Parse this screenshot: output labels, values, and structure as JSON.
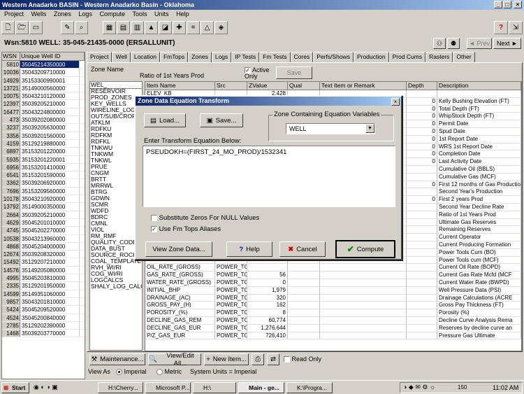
{
  "window": {
    "title": "Western Anadarko BASIN - Western Anadarko Basin - Oklahoma"
  },
  "menu": [
    "Project",
    "Wells",
    "Zones",
    "Logs",
    "Compute",
    "Tools",
    "Units",
    "Help"
  ],
  "well_header": "Wsn:5810 WELL: 35-045-21435-0000 (ERSALLUNIT)",
  "nav": {
    "prev": "Prev",
    "next": "Next"
  },
  "well_list": {
    "headers": [
      "WSN",
      "Unique Well ID"
    ],
    "rows": [
      {
        "wsn": "5810",
        "id": "35045214350000",
        "sel": true
      },
      {
        "wsn": "10036",
        "id": "35043209710000"
      },
      {
        "wsn": "14929",
        "id": "35153300990001"
      },
      {
        "wsn": "13721",
        "id": "35149000560000"
      },
      {
        "wsn": "10075",
        "id": "35043210120000"
      },
      {
        "wsn": "12397",
        "id": "35039205210000"
      },
      {
        "wsn": "16477",
        "id": "35043224800000"
      },
      {
        "wsn": "473",
        "id": "35039202080000"
      },
      {
        "wsn": "3237",
        "id": "35039205630000"
      },
      {
        "wsn": "3356",
        "id": "35039201560000"
      },
      {
        "wsn": "4159",
        "id": "35129219880000"
      },
      {
        "wsn": "6897",
        "id": "35153201220000"
      },
      {
        "wsn": "5935",
        "id": "35153201220001"
      },
      {
        "wsn": "6956",
        "id": "35153201410000"
      },
      {
        "wsn": "6541",
        "id": "35153201590000"
      },
      {
        "wsn": "3362",
        "id": "35039206920000"
      },
      {
        "wsn": "7696",
        "id": "35153209560000"
      },
      {
        "wsn": "10178",
        "id": "35043210920000"
      },
      {
        "wsn": "13792",
        "id": "35149000350000"
      },
      {
        "wsn": "2664",
        "id": "35039205210000"
      },
      {
        "wsn": "4629",
        "id": "35045201010000"
      },
      {
        "wsn": "4745",
        "id": "35045202270000"
      },
      {
        "wsn": "10538",
        "id": "35043213960000"
      },
      {
        "wsn": "4868",
        "id": "35045204000000"
      },
      {
        "wsn": "12674",
        "id": "35039208320000"
      },
      {
        "wsn": "15492",
        "id": "35129207210000"
      },
      {
        "wsn": "14576",
        "id": "35149205080000"
      },
      {
        "wsn": "4995",
        "id": "35045203810000"
      },
      {
        "wsn": "2335",
        "id": "35129201950000"
      },
      {
        "wsn": "14599",
        "id": "35149351060000"
      },
      {
        "wsn": "9857",
        "id": "35043201810000"
      },
      {
        "wsn": "5424",
        "id": "35045209520000"
      },
      {
        "wsn": "4524",
        "id": "35045200840000"
      },
      {
        "wsn": "2785",
        "id": "35129202390000"
      },
      {
        "wsn": "1468",
        "id": "35039203770000"
      }
    ]
  },
  "tabs": [
    "Project",
    "Well",
    "Location",
    "FmTops",
    "Zones",
    "Logs",
    "IP Tests",
    "Fm Tests",
    "Cores",
    "Perfs/Shows",
    "Production",
    "Prod Cums",
    "Rasters",
    "Other"
  ],
  "zones_panel": {
    "zone_name_label": "Zone Name",
    "zone_name_value": "Ratio of 1st Years Prod",
    "active_only": "Active Only",
    "save": "Save",
    "zone_list": [
      "WEL_",
      "RESERVOIR",
      "PROD_ZONES",
      "KEY_WELLS",
      "WIRELINE_LOGS",
      "OUT/SUB/CROP",
      "ATKLM",
      "RDFKU",
      "RDFKM",
      "RDFKL",
      "TNKWU",
      "TNKWM",
      "TNKWL",
      "PRUE",
      "CNGM",
      "BRTT",
      "MRRWL",
      "BTRG",
      "GDWN",
      "SCMR",
      "WDFD",
      "BDRC",
      "CMNL",
      "VIOL",
      "RM_RMF",
      "QUALITY_CODE",
      "DATA_BUST",
      "SOURCE_ROCK_TE",
      "COAL_TEMPLATE",
      "RVH_WI/RI",
      "COG_WI/RI",
      "LOGCALCS",
      "SHALY_LOG_CALCS"
    ],
    "grid_headers": [
      "Item Name",
      "Src",
      "ZValue",
      "Qual",
      "Text Item or Remark",
      "Depth",
      "Description"
    ],
    "grid_rows": [
      {
        "item": "ELEV_KB",
        "src": "",
        "zval": "2,428",
        "depth": "",
        "desc": ""
      },
      {
        "item": "",
        "src": "",
        "zval": "",
        "depth": "0",
        "desc": "Kelly Bushing Elevation  (FT)"
      },
      {
        "item": "",
        "src": "",
        "zval": "",
        "depth": "0",
        "desc": "Total Depth  (FT)"
      },
      {
        "item": "",
        "src": "",
        "zval": "",
        "depth": "0",
        "desc": "WhipStock Depth  (FT)"
      },
      {
        "item": "",
        "src": "",
        "zval": "",
        "depth": "0",
        "desc": "Permit Date"
      },
      {
        "item": "",
        "src": "",
        "zval": "",
        "depth": "0",
        "desc": "Spud Date"
      },
      {
        "item": "",
        "src": "",
        "zval": "",
        "depth": "0",
        "desc": "1st Report Date"
      },
      {
        "item": "",
        "src": "",
        "zval": "",
        "depth": "0",
        "desc": "WRS 1st Report Date"
      },
      {
        "item": "",
        "src": "",
        "zval": "",
        "depth": "0",
        "desc": "Completion Date"
      },
      {
        "item": "",
        "src": "",
        "zval": "",
        "depth": "0",
        "desc": "Last Activity Date"
      },
      {
        "item": "",
        "src": "",
        "zval": "",
        "depth": "",
        "desc": "Cumulative Oil  (BBLS)"
      },
      {
        "item": "",
        "src": "",
        "zval": "",
        "depth": "",
        "desc": "Cumulative Gas  (MCF)"
      },
      {
        "item": "",
        "src": "",
        "zval": "",
        "depth": "0",
        "desc": "First 12 months of Gas Production"
      },
      {
        "item": "",
        "src": "",
        "zval": "",
        "depth": "",
        "desc": "Second Year's Production"
      },
      {
        "item": "",
        "src": "",
        "zval": "",
        "depth": "0",
        "desc": "First 2 years Prod"
      },
      {
        "item": "",
        "src": "",
        "zval": "",
        "depth": "",
        "desc": "Second Year Decline Rate"
      },
      {
        "item": "",
        "src": "",
        "zval": "",
        "depth": "",
        "desc": "Ratio of 1st Years Prod"
      },
      {
        "item": "",
        "src": "",
        "zval": "",
        "depth": "",
        "desc": "Ultimate Gas Reserves"
      },
      {
        "item": "",
        "src": "",
        "zval": "",
        "depth": "",
        "desc": "Remaining Reserves"
      },
      {
        "item": "",
        "src": "",
        "zval": "",
        "depth": "",
        "desc": "Current Operator"
      },
      {
        "item": "",
        "src": "",
        "zval": "",
        "depth": "",
        "desc": "Current Producing Formation"
      },
      {
        "item": "",
        "src": "",
        "zval": "",
        "depth": "",
        "desc": "Power Tools Cum  (BO)"
      },
      {
        "item": "",
        "src": "",
        "zval": "",
        "depth": "",
        "desc": "Power Tools cum  (MCF)"
      },
      {
        "item": "OIL_RATE_(GROSS)",
        "src": "POWER_TC",
        "zval": "",
        "depth": "",
        "desc": "Current Oil Rate  (BOPD)"
      },
      {
        "item": "GAS_RATE_(GROSS)",
        "src": "POWER_TC",
        "zval": "56",
        "depth": "",
        "desc": "Current Gas Rate Mcfd  (MCF"
      },
      {
        "item": "WATER_RATE_(GROSS)",
        "src": "POWER_TC",
        "zval": "0",
        "depth": "",
        "desc": "Current Water Rate  (BWPD)"
      },
      {
        "item": "INITIAL_BHP",
        "src": "POWER_TC",
        "zval": "1,979",
        "depth": "",
        "desc": "Well Pressure Data  (PSI)"
      },
      {
        "item": "DRAINAGE_(AC)",
        "src": "POWER_TC",
        "zval": "320",
        "depth": "",
        "desc": "Drainage Calculations  (ACRE"
      },
      {
        "item": "GROSS_PAY_(H)",
        "src": "POWER_TC",
        "zval": "162",
        "depth": "",
        "desc": "Gross Pay Thickness  (FT)"
      },
      {
        "item": "POROSITY_(%)",
        "src": "POWER_TC",
        "zval": "8",
        "depth": "",
        "desc": "Porosity  (%)"
      },
      {
        "item": "DECLINE_GAS_REM",
        "src": "POWER_TC",
        "zval": "60,774",
        "depth": "",
        "desc": "Decline Curve Analysis Rema"
      },
      {
        "item": "DECLINE_GAS_EUR",
        "src": "POWER_TC",
        "zval": "1,276,644",
        "depth": "",
        "desc": "Reserves by decline curve an"
      },
      {
        "item": "P/Z_GAS_EUR",
        "src": "POWER_TC",
        "zval": "726,410",
        "depth": "",
        "desc": "Pressure Gas Ultimate"
      }
    ]
  },
  "dialog": {
    "title": "Zone Data Equation Transform",
    "load": "Load...",
    "save": "Save...",
    "zone_group_label": "Zone Containing Equation Variables",
    "zone_selected": "WELL",
    "equation_label": "Enter Transform Equation Below:",
    "equation": "PSEUDOKH=(FIRST_24_MO_PROD)/1532341",
    "opt_null": "Substitute Zeros For NULL Values",
    "opt_aliases": "Use Fm Tops Aliases",
    "opt_null_checked": false,
    "opt_aliases_checked": true,
    "view_zone_data": "View Zone Data...",
    "help": "Help",
    "cancel": "Cancel",
    "compute": "Compute"
  },
  "bottom": {
    "maintenance": "Maintenance...",
    "view_edit": "View/Edit All...",
    "new_item": "New Item...",
    "read_only": "Read Only"
  },
  "status": {
    "view_as": "View As",
    "imperial": "Imperial",
    "metric": "Metric",
    "system_units": "System Units = Imperial"
  },
  "taskbar": {
    "start": "Start",
    "tasks": [
      "H:\\Cherry...",
      "Microsoft P...",
      "H:\\",
      "Main - ge...",
      "K:\\Progra..."
    ],
    "tray_num": "150",
    "time": "11:02 AM"
  },
  "colors": {
    "title_start": "#0a246a",
    "title_end": "#a6caf0",
    "face": "#d4d0c8",
    "selection": "#0a246a"
  }
}
